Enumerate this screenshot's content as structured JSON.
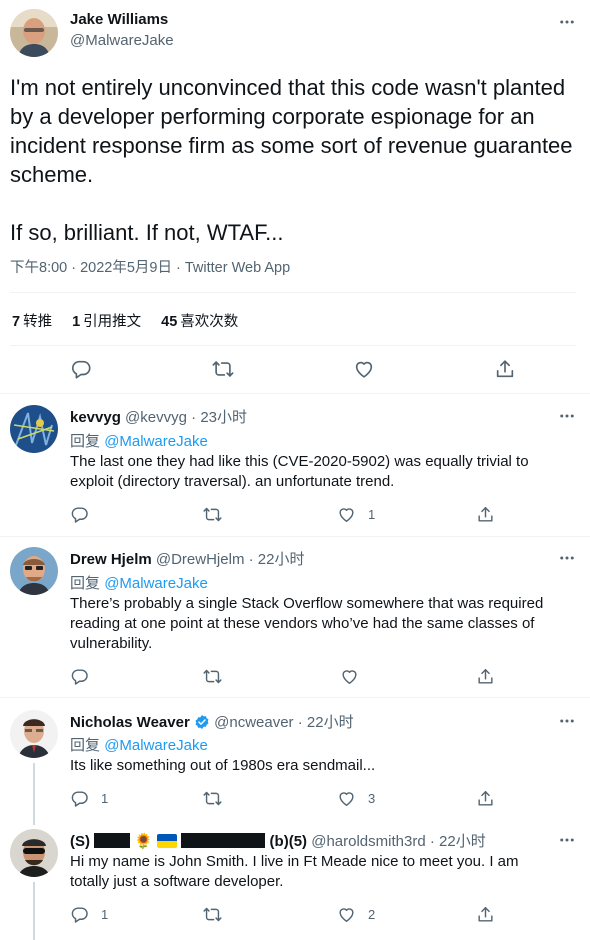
{
  "main_tweet": {
    "author_name": "Jake Williams",
    "author_handle": "@MalwareJake",
    "text": "I'm not entirely unconvinced that this code wasn't planted by a developer performing corporate espionage for an incident response firm as some sort of revenue guarantee scheme.\n\nIf so, brilliant. If not, WTAF...",
    "meta": "下午8:00 · 2022年5月9日 · Twitter Web App",
    "stats": {
      "retweets_count": "7",
      "retweets_label": "转推",
      "quotes_count": "1",
      "quotes_label": "引用推文",
      "likes_count": "45",
      "likes_label": "喜欢次数"
    }
  },
  "reply_prefix": "回复",
  "replies": [
    {
      "name": "kevvyg",
      "handle": "@kevvyg",
      "dot": "·",
      "time": "23小时",
      "reply_to": "@MalwareJake",
      "text": "The last one they had like this (CVE-2020-5902) was equally trivial to exploit (directory traversal). an unfortunate trend.",
      "reply_count": "",
      "retweet_count": "",
      "like_count": "1"
    },
    {
      "name": "Drew Hjelm",
      "handle": "@DrewHjelm",
      "dot": "·",
      "time": "22小时",
      "reply_to": "@MalwareJake",
      "text": "There’s probably a single Stack Overflow somewhere that was required reading at one point at these vendors who’ve had the same classes of vulnerability.",
      "reply_count": "",
      "retweet_count": "",
      "like_count": ""
    },
    {
      "name": "Nicholas Weaver",
      "handle": "@ncweaver",
      "dot": "·",
      "time": "22小时",
      "reply_to": "@MalwareJake",
      "text": "Its like something out of 1980s era sendmail...",
      "reply_count": "1",
      "retweet_count": "",
      "like_count": "3"
    },
    {
      "name_prefix": "(S)",
      "name_suffix": "(b)(5)",
      "sunflower": "🌻",
      "handle": "@haroldsmith3rd",
      "dot": "·",
      "time": "22小时",
      "text": "Hi my name is John Smith. I live in Ft Meade nice to meet you. I am totally just a software developer.",
      "reply_count": "1",
      "retweet_count": "",
      "like_count": "2"
    }
  ],
  "colors": {
    "text": "#0f1419",
    "secondary": "#536471",
    "accent": "#1d9bf0",
    "divider": "#eff3f4",
    "thread": "#cfd9de",
    "ukraine_blue": "#0057b7",
    "ukraine_yellow": "#ffd700"
  },
  "icons": [
    "more-icon",
    "reply-icon",
    "retweet-icon",
    "like-icon",
    "share-icon",
    "verified-icon"
  ]
}
